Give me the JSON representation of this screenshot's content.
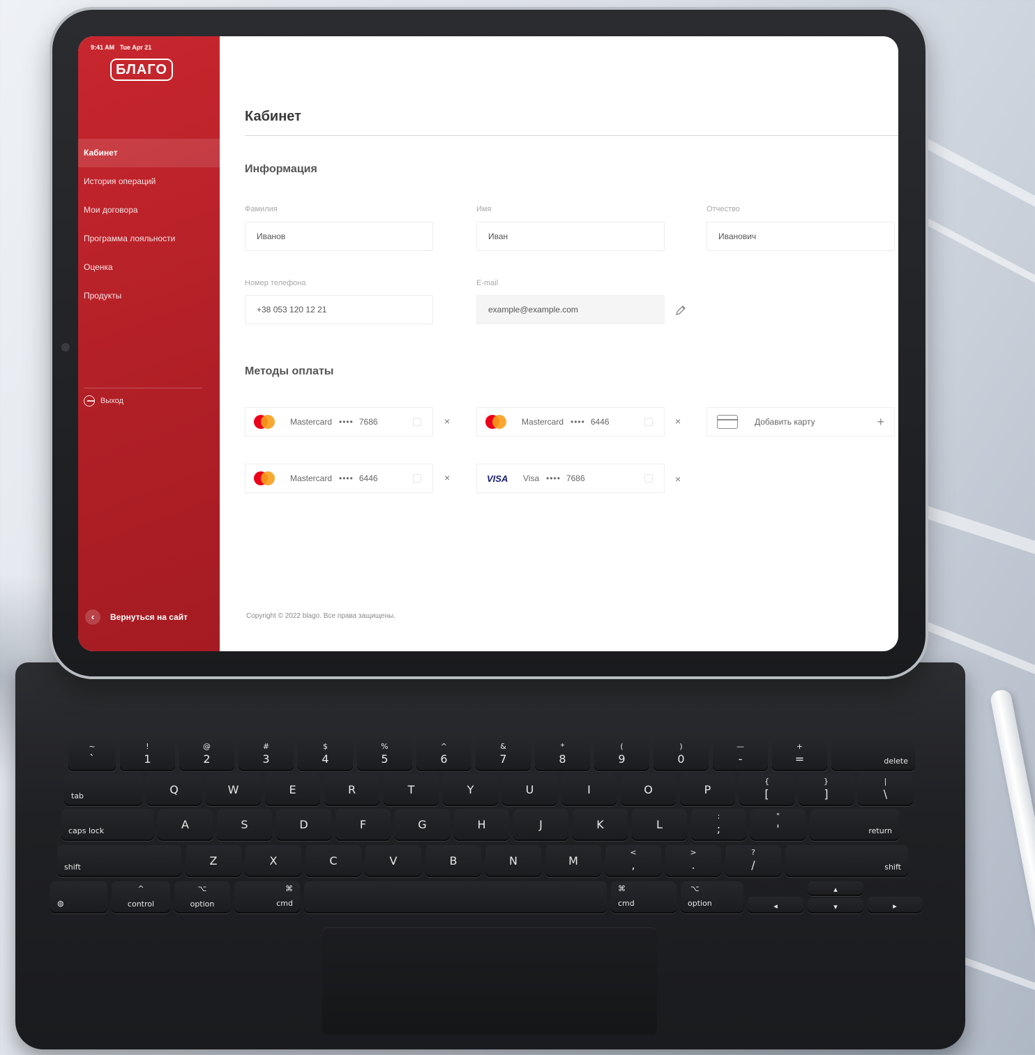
{
  "status_bar": {
    "time": "9:41 AM",
    "date": "Tue Apr 21"
  },
  "brand": {
    "logo_text": "БЛАГО",
    "accent_color": "#c8262e"
  },
  "sidebar": {
    "items": [
      {
        "label": "Кабинет",
        "active": true
      },
      {
        "label": "История операций"
      },
      {
        "label": "Мои договора"
      },
      {
        "label": "Программа лояльности"
      },
      {
        "label": "Оценка"
      },
      {
        "label": "Продукты"
      }
    ],
    "logout_label": "Выход",
    "back_label": "Вернуться на сайт",
    "back_icon": "chevron-left-icon",
    "logout_icon": "logout-icon"
  },
  "main": {
    "title": "Кабинет",
    "info_section": {
      "title": "Информация",
      "fields": {
        "last_name": {
          "label": "Фамилия",
          "value": "Иванов"
        },
        "first_name": {
          "label": "Имя",
          "value": "Иван"
        },
        "patronymic": {
          "label": "Отчество",
          "value": "Иванович"
        },
        "phone": {
          "label": "Номер телефона",
          "value": "+38 053 120 12 21"
        },
        "email": {
          "label": "E-mail",
          "value": "example@example.com"
        }
      },
      "edit_icon": "pencil-icon"
    },
    "payment_section": {
      "title": "Методы оплаты",
      "cards": [
        {
          "brand": "Mastercard",
          "dots": "••••",
          "last4": "7686"
        },
        {
          "brand": "Mastercard",
          "dots": "••••",
          "last4": "6446"
        },
        {
          "brand": "Mastercard",
          "dots": "••••",
          "last4": "6446"
        },
        {
          "brand": "Visa",
          "logo_text": "VISA",
          "dots": "••••",
          "last4": "7686"
        }
      ],
      "remove_symbol": "×",
      "add_card": {
        "label": "Добавить карту",
        "symbol": "+"
      }
    },
    "copyright": "Copyright © 2022 blago. Все права защищены."
  },
  "keyboard": {
    "row1": [
      {
        "t": "~",
        "m": "`"
      },
      {
        "t": "!",
        "m": "1"
      },
      {
        "t": "@",
        "m": "2"
      },
      {
        "t": "#",
        "m": "3"
      },
      {
        "t": "$",
        "m": "4"
      },
      {
        "t": "%",
        "m": "5"
      },
      {
        "t": "^",
        "m": "6"
      },
      {
        "t": "&",
        "m": "7"
      },
      {
        "t": "*",
        "m": "8"
      },
      {
        "t": "(",
        "m": "9"
      },
      {
        "t": ")",
        "m": "0"
      },
      {
        "t": "—",
        "m": "-"
      },
      {
        "t": "+",
        "m": "="
      }
    ],
    "delete": "delete",
    "tab": "tab",
    "row2": [
      "Q",
      "W",
      "E",
      "R",
      "T",
      "Y",
      "U",
      "I",
      "O",
      "P"
    ],
    "row2_extra": [
      {
        "t": "{",
        "m": "["
      },
      {
        "t": "}",
        "m": "]"
      },
      {
        "t": "|",
        "m": "\\"
      }
    ],
    "caps": "caps lock",
    "row3": [
      "A",
      "S",
      "D",
      "F",
      "G",
      "H",
      "J",
      "K",
      "L"
    ],
    "row3_extra": [
      {
        "t": ":",
        "m": ";"
      },
      {
        "t": "\"",
        "m": "'"
      }
    ],
    "return": "return",
    "shift": "shift",
    "row4": [
      "Z",
      "X",
      "C",
      "V",
      "B",
      "N",
      "M"
    ],
    "row4_extra": [
      {
        "t": "<",
        "m": ","
      },
      {
        "t": ">",
        "m": "."
      },
      {
        "t": "?",
        "m": "/"
      }
    ],
    "control": "control",
    "control_sym": "^",
    "option": "option",
    "option_sym": "⌥",
    "cmd": "cmd",
    "cmd_sym": "⌘",
    "globe_icon": "globe-icon",
    "arrows": {
      "left": "◂",
      "up": "▴",
      "down": "▾",
      "right": "▸"
    }
  }
}
